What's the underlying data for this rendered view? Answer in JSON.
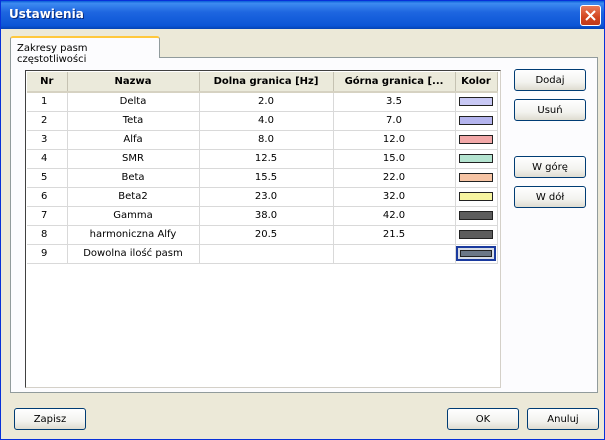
{
  "window": {
    "title": "Ustawienia"
  },
  "tab": {
    "label": "Zakresy pasm częstotliwości"
  },
  "table": {
    "headers": {
      "nr": "Nr",
      "nazwa": "Nazwa",
      "dolna": "Dolna granica [Hz]",
      "gorna": "Górna granica [...",
      "kolor": "Kolor"
    },
    "rows": [
      {
        "nr": "1",
        "nazwa": "Delta",
        "dolna": "2.0",
        "gorna": "3.5",
        "color": "#c8c8f4"
      },
      {
        "nr": "2",
        "nazwa": "Teta",
        "dolna": "4.0",
        "gorna": "7.0",
        "color": "#b4b4ee"
      },
      {
        "nr": "3",
        "nazwa": "Alfa",
        "dolna": "8.0",
        "gorna": "12.0",
        "color": "#f2a8a8"
      },
      {
        "nr": "4",
        "nazwa": "SMR",
        "dolna": "12.5",
        "gorna": "15.0",
        "color": "#b4e4d0"
      },
      {
        "nr": "5",
        "nazwa": "Beta",
        "dolna": "15.5",
        "gorna": "22.0",
        "color": "#f6c4a4"
      },
      {
        "nr": "6",
        "nazwa": "Beta2",
        "dolna": "23.0",
        "gorna": "32.0",
        "color": "#f6f4a0"
      },
      {
        "nr": "7",
        "nazwa": "Gamma",
        "dolna": "38.0",
        "gorna": "42.0",
        "color": "#5c5c5c"
      },
      {
        "nr": "8",
        "nazwa": "harmoniczna Alfy",
        "dolna": "20.5",
        "gorna": "21.5",
        "color": "#5c5c5c"
      },
      {
        "nr": "9",
        "nazwa": "Dowolna ilość pasm",
        "dolna": "",
        "gorna": "",
        "color": "#6b7787"
      }
    ]
  },
  "buttons": {
    "dodaj": "Dodaj",
    "usun": "Usuń",
    "w_gore": "W górę",
    "w_dol": "W dół",
    "zapisz": "Zapisz",
    "ok": "OK",
    "anuluj": "Anuluj"
  },
  "icons": {
    "close": "close-icon"
  },
  "colors": {
    "titlebar": "#0b55d6",
    "tab_accent": "#ffc83c",
    "dialog_bg": "#ece9d8"
  }
}
